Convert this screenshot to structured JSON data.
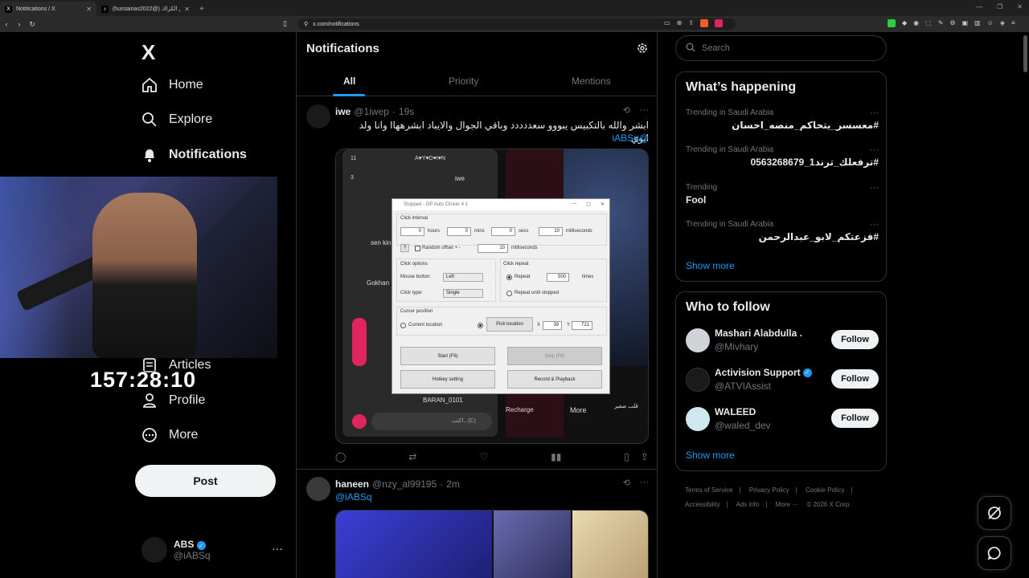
{
  "browser": {
    "tabs": [
      {
        "title": "Notifications / X",
        "favicon": "X"
      },
      {
        "title": "(hussainas2022@) حسين الكراك",
        "favicon": "♪"
      }
    ],
    "url": "x.com/notifications"
  },
  "nav": {
    "logo": "X",
    "items": [
      {
        "label": "Home",
        "icon": "home-icon"
      },
      {
        "label": "Explore",
        "icon": "search-icon"
      },
      {
        "label": "Notifications",
        "icon": "bell-icon"
      },
      {
        "label": "Articles",
        "icon": "article-icon"
      },
      {
        "label": "Profile",
        "icon": "profile-icon"
      },
      {
        "label": "More",
        "icon": "more-circle-icon"
      }
    ],
    "post_label": "Post",
    "account": {
      "name": "ABS",
      "handle": "@iABSq"
    }
  },
  "overlay": {
    "timer": "157:28:10"
  },
  "main": {
    "title": "Notifications",
    "tabs": [
      "All",
      "Priority",
      "Mentions"
    ],
    "active_tab": "All",
    "tweets": [
      {
        "name": "iwe",
        "handle": "@1iwep",
        "time": "19s",
        "text": "ابشر والله بالتكبيس يبووو سعددددد وباقي الجوال والايباد ابشرههاا وانا ولد ابوي",
        "mention": "@iABSq"
      },
      {
        "name": "haneen",
        "handle": "@nzy_al99195",
        "time": "2m",
        "mention": "@iABSq"
      }
    ],
    "stream_overlay": {
      "row1": "A♥Y♥D♥I♥N",
      "row2": "iwe",
      "gift_user": "BARAN_0101",
      "recharge": "Recharge",
      "more": "More",
      "gift_name": "قلب صغير",
      "comment_placeholder": "اكتب...(C)",
      "side_names": [
        "sen kin",
        "Gokhan"
      ]
    },
    "auto_clicker": {
      "title": "Stopped - OP Auto Clicker 4.1",
      "click_interval": "Click interval",
      "hours_val": "0",
      "hours": "hours",
      "mins_val": "0",
      "mins": "mins",
      "secs_val": "0",
      "secs": "secs",
      "ms_val": "10",
      "ms": "milliseconds",
      "random_offset": "Random offset + -",
      "random_ms_val": "10",
      "random_ms": "milliseconds",
      "click_options": "Click options",
      "mouse_button": "Mouse button:",
      "mouse_button_val": "Left",
      "click_type": "Click type:",
      "click_type_val": "Single",
      "click_repeat": "Click repeat",
      "repeat": "Repeat",
      "repeat_val": "500",
      "times": "times",
      "repeat_until": "Repeat until stopped",
      "cursor_position": "Cursor position",
      "current_location": "Current location",
      "pick_location": "Pick location",
      "x_label": "X",
      "x_val": "39",
      "y_label": "Y",
      "y_val": "721",
      "start": "Start (F6)",
      "stop": "Stop (F6)",
      "hotkey": "Hotkey setting",
      "record": "Record & Playback"
    }
  },
  "right": {
    "search_placeholder": "Search",
    "happening_title": "What’s happening",
    "trends": [
      {
        "context": "Trending in Saudi Arabia",
        "name": "#معسسر_يتحاكم_منصه_احسان"
      },
      {
        "context": "Trending in Saudi Arabia",
        "name": "#ترفعلك_ترند1_0563268679"
      },
      {
        "context": "Trending",
        "name": "Fool"
      },
      {
        "context": "Trending in Saudi Arabia",
        "name": "#فزعتكم_لابو_عبدالرحمن"
      }
    ],
    "show_more": "Show more",
    "follow_title": "Who to follow",
    "follow": [
      {
        "name": "Mashari Alabdulla .",
        "handle": "@Mivhary",
        "verified": false
      },
      {
        "name": "Activision Support",
        "handle": "@ATVIAssist",
        "verified": true
      },
      {
        "name": "WALEED",
        "handle": "@waled_dev",
        "verified": false
      }
    ],
    "follow_label": "Follow",
    "footer": [
      "Terms of Service",
      "Privacy Policy",
      "Cookie Policy",
      "Accessibility",
      "Ads info",
      "More ···",
      "© 2026 X Corp."
    ]
  },
  "colors": {
    "accent": "#1d9bf0",
    "bg": "#000000",
    "border": "#2f3336",
    "muted": "#71767b"
  }
}
